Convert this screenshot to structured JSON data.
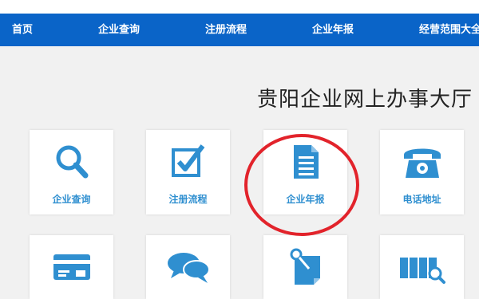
{
  "nav": {
    "items": [
      {
        "label": "首页"
      },
      {
        "label": "企业查询"
      },
      {
        "label": "注册流程"
      },
      {
        "label": "企业年报"
      },
      {
        "label": "经营范围大全"
      }
    ]
  },
  "main": {
    "title": "贵阳企业网上办事大厅",
    "cards": [
      {
        "label": "企业查询",
        "icon": "magnifier-icon"
      },
      {
        "label": "注册流程",
        "icon": "checkbox-icon"
      },
      {
        "label": "企业年报",
        "icon": "document-icon"
      },
      {
        "label": "电话地址",
        "icon": "telephone-icon"
      },
      {
        "label": "",
        "icon": "credit-card-icon"
      },
      {
        "label": "",
        "icon": "chat-bubbles-icon"
      },
      {
        "label": "",
        "icon": "pinned-note-icon"
      },
      {
        "label": "",
        "icon": "files-search-icon"
      }
    ]
  },
  "colors": {
    "nav_bg": "#0a64c8",
    "icon_blue": "#2f8fd0",
    "highlight_circle": "#e2232b",
    "page_bg": "#f1f1f1"
  }
}
